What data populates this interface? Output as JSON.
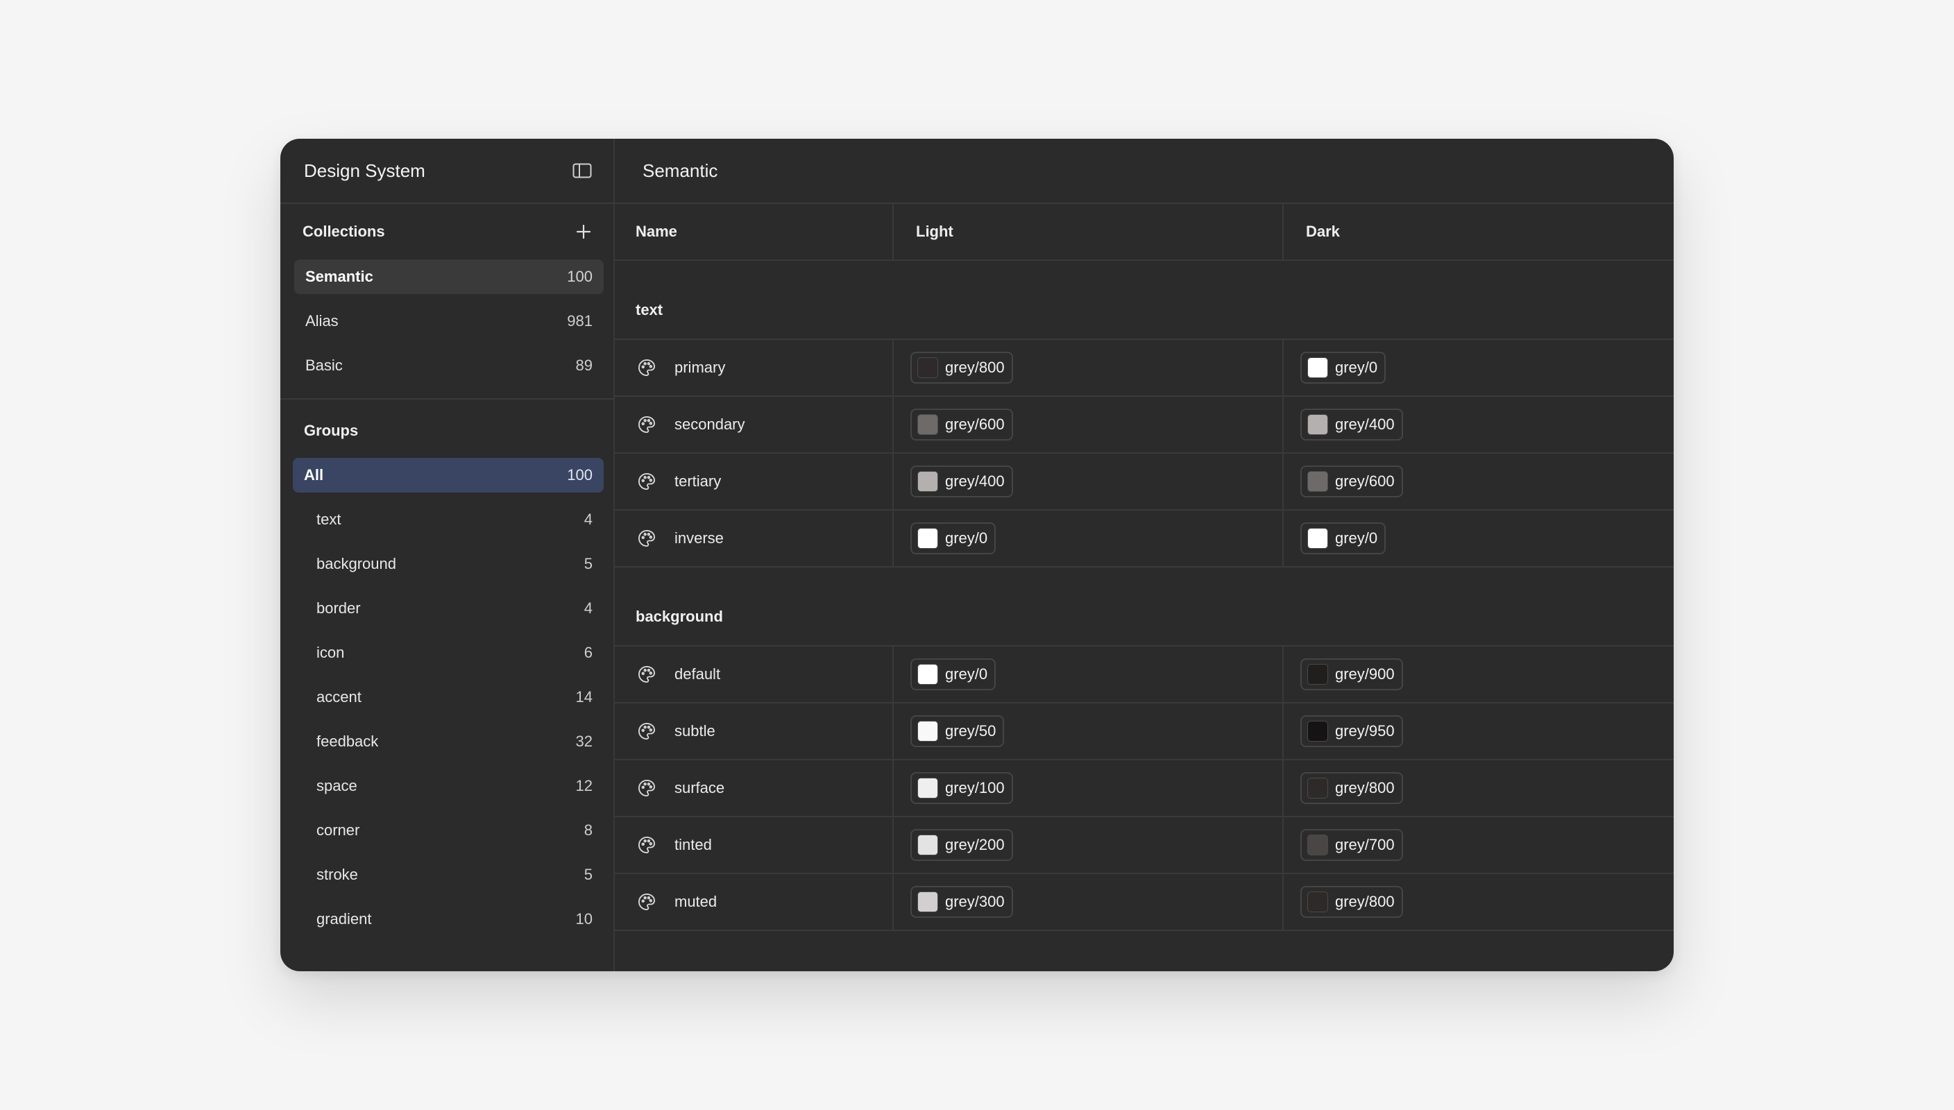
{
  "sidebar": {
    "title": "Design System",
    "collections": {
      "title": "Collections",
      "items": [
        {
          "label": "Semantic",
          "count": "100"
        },
        {
          "label": "Alias",
          "count": "981"
        },
        {
          "label": "Basic",
          "count": "89"
        }
      ]
    },
    "groups": {
      "title": "Groups",
      "items": [
        {
          "label": "All",
          "count": "100"
        },
        {
          "label": "text",
          "count": "4"
        },
        {
          "label": "background",
          "count": "5"
        },
        {
          "label": "border",
          "count": "4"
        },
        {
          "label": "icon",
          "count": "6"
        },
        {
          "label": "accent",
          "count": "14"
        },
        {
          "label": "feedback",
          "count": "32"
        },
        {
          "label": "space",
          "count": "12"
        },
        {
          "label": "corner",
          "count": "8"
        },
        {
          "label": "stroke",
          "count": "5"
        },
        {
          "label": "gradient",
          "count": "10"
        }
      ]
    }
  },
  "main": {
    "title": "Semantic",
    "columns": {
      "name": "Name",
      "light": "Light",
      "dark": "Dark"
    },
    "groups": [
      {
        "name": "text",
        "rows": [
          {
            "name": "primary",
            "light": {
              "label": "grey/800",
              "color": "#2e2a2a"
            },
            "dark": {
              "label": "grey/0",
              "color": "#ffffff"
            }
          },
          {
            "name": "secondary",
            "light": {
              "label": "grey/600",
              "color": "#6e6a6a"
            },
            "dark": {
              "label": "grey/400",
              "color": "#b4b0b0"
            }
          },
          {
            "name": "tertiary",
            "light": {
              "label": "grey/400",
              "color": "#b4b0b0"
            },
            "dark": {
              "label": "grey/600",
              "color": "#6e6a6a"
            }
          },
          {
            "name": "inverse",
            "light": {
              "label": "grey/0",
              "color": "#ffffff"
            },
            "dark": {
              "label": "grey/0",
              "color": "#ffffff"
            }
          }
        ]
      },
      {
        "name": "background",
        "rows": [
          {
            "name": "default",
            "light": {
              "label": "grey/0",
              "color": "#ffffff"
            },
            "dark": {
              "label": "grey/900",
              "color": "#211e1e"
            }
          },
          {
            "name": "subtle",
            "light": {
              "label": "grey/50",
              "color": "#f8f8f8"
            },
            "dark": {
              "label": "grey/950",
              "color": "#151313"
            }
          },
          {
            "name": "surface",
            "light": {
              "label": "grey/100",
              "color": "#efefef"
            },
            "dark": {
              "label": "grey/800",
              "color": "#2e2a2a"
            }
          },
          {
            "name": "tinted",
            "light": {
              "label": "grey/200",
              "color": "#e4e3e3"
            },
            "dark": {
              "label": "grey/700",
              "color": "#4a4646"
            }
          },
          {
            "name": "muted",
            "light": {
              "label": "grey/300",
              "color": "#d1cfcf"
            },
            "dark": {
              "label": "grey/800",
              "color": "#2e2a2a"
            }
          }
        ]
      }
    ]
  },
  "icons": {
    "sidebar_toggle": "panel-left-icon",
    "add": "plus-icon",
    "token": "palette-icon"
  },
  "colors": {
    "window_bg": "#2b2b2b",
    "page_bg": "#f5f5f5",
    "active_group": "#3a4563",
    "active_collection": "#3a3a3a"
  }
}
